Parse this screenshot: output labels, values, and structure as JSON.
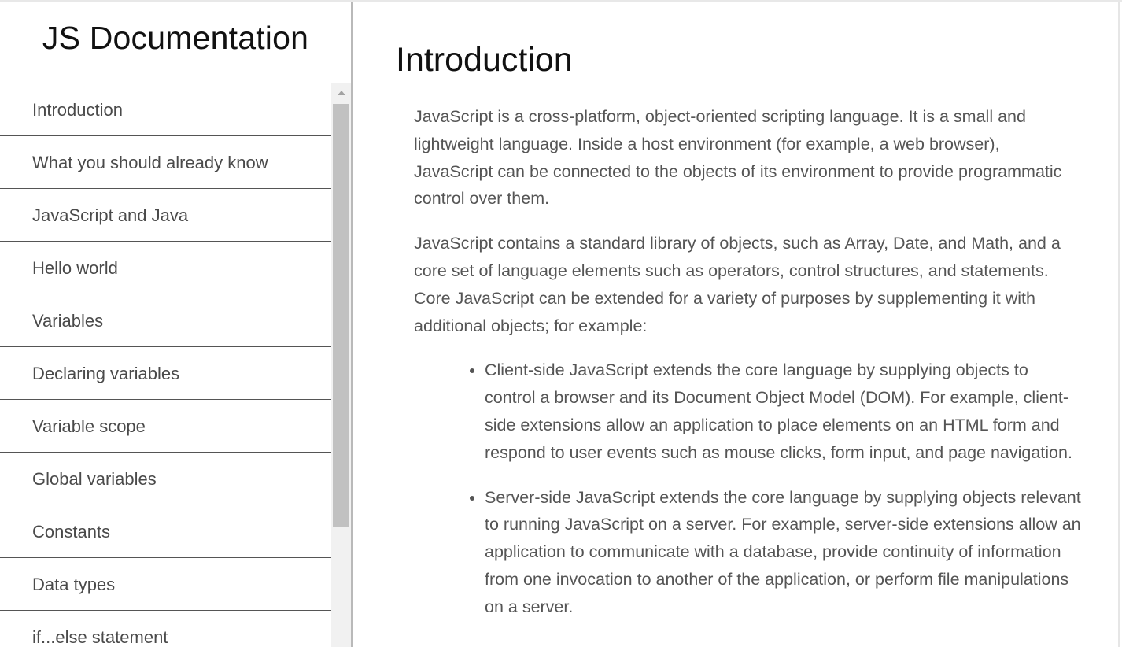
{
  "sidebar": {
    "title": "JS Documentation",
    "items": [
      {
        "label": "Introduction"
      },
      {
        "label": "What you should already know"
      },
      {
        "label": "JavaScript and Java"
      },
      {
        "label": "Hello world"
      },
      {
        "label": "Variables"
      },
      {
        "label": "Declaring variables"
      },
      {
        "label": "Variable scope"
      },
      {
        "label": "Global variables"
      },
      {
        "label": "Constants"
      },
      {
        "label": "Data types"
      },
      {
        "label": "if...else statement"
      }
    ]
  },
  "main": {
    "heading": "Introduction",
    "paragraphs": [
      "JavaScript is a cross-platform, object-oriented scripting language. It is a small and lightweight language. Inside a host environment (for example, a web browser), JavaScript can be connected to the objects of its environment to provide programmatic control over them.",
      "JavaScript contains a standard library of objects, such as Array, Date, and Math, and a core set of language elements such as operators, control structures, and statements. Core JavaScript can be extended for a variety of purposes by supplementing it with additional objects; for example:"
    ],
    "bullets": [
      "Client-side JavaScript extends the core language by supplying objects to control a browser and its Document Object Model (DOM). For example, client-side extensions allow an application to place elements on an HTML form and respond to user events such as mouse clicks, form input, and page navigation.",
      "Server-side JavaScript extends the core language by supplying objects relevant to running JavaScript on a server. For example, server-side extensions allow an application to communicate with a database, provide continuity of information from one invocation to another of the application, or perform file manipulations on a server."
    ]
  },
  "colors": {
    "divider": "#555555",
    "nav_text": "#4a4a4a",
    "body_text": "#555555",
    "heading_text": "#111111",
    "scroll_track": "#f1f1f1",
    "scroll_thumb": "#c1c1c1"
  }
}
